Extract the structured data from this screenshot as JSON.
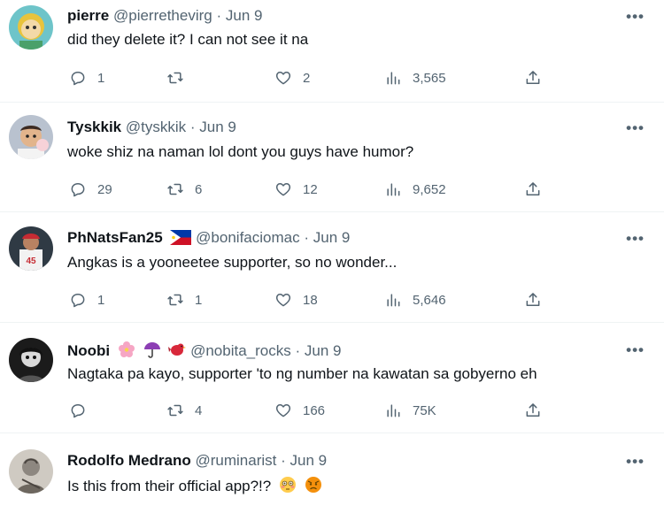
{
  "tweets": [
    {
      "name": "pierre",
      "handle": "@pierrethevirg",
      "sep": "·",
      "date": "Jun 9",
      "flag": false,
      "emojis": [],
      "text": "did they delete it? I can not see it na",
      "replies": "1",
      "retweets": "",
      "likes": "2",
      "views": "3,565",
      "more": "•••"
    },
    {
      "name": "Tyskkik",
      "handle": "@tyskkik",
      "sep": "·",
      "date": "Jun 9",
      "flag": false,
      "emojis": [],
      "text": "woke shiz na naman lol dont you guys have humor?",
      "replies": "29",
      "retweets": "6",
      "likes": "12",
      "views": "9,652",
      "more": "•••"
    },
    {
      "name": "PhNatsFan25",
      "handle": "@bonifaciomac",
      "sep": "·",
      "date": "Jun 9",
      "flag": true,
      "emojis": [
        "philippines-flag"
      ],
      "text": "Angkas is a yooneetee supporter, so no wonder...",
      "replies": "1",
      "retweets": "1",
      "likes": "18",
      "views": "5,646",
      "more": "•••"
    },
    {
      "name": "Noobi",
      "handle": "@nobita_rocks",
      "sep": "·",
      "date": "Jun 9",
      "flag": false,
      "emojis": [
        "cherry-blossom",
        "umbrella",
        "bird"
      ],
      "text": "Nagtaka pa kayo, supporter 'to ng number na kawatan sa gobyerno eh",
      "replies": "",
      "retweets": "4",
      "likes": "166",
      "views": "75K",
      "more": "•••"
    },
    {
      "name": "Rodolfo Medrano",
      "handle": "@ruminarist",
      "sep": "·",
      "date": "Jun 9",
      "flag": false,
      "emojis": [],
      "text": "Is this from their official app?!?",
      "text_emojis": [
        "flushed-face",
        "angry-face"
      ],
      "replies": "",
      "retweets": "",
      "likes": "",
      "views": "",
      "more": "•••"
    }
  ],
  "colors": {
    "text_primary": "#0f1419",
    "text_secondary": "#536471",
    "divider": "#eff3f4"
  }
}
